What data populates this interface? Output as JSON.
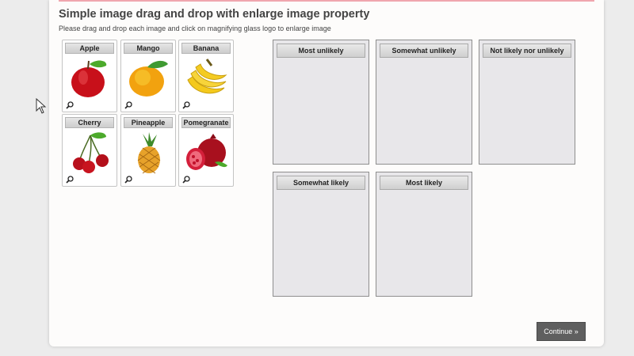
{
  "header": {
    "title": "Simple image drag and drop with enlarge image property",
    "subtitle": "Please drag and drop each image and click on magnifying glass logo to enlarge image"
  },
  "images": [
    {
      "label": "Apple"
    },
    {
      "label": "Mango"
    },
    {
      "label": "Banana"
    },
    {
      "label": "Cherry"
    },
    {
      "label": "Pineapple"
    },
    {
      "label": "Pomegranate"
    }
  ],
  "buckets": [
    {
      "label": "Most unlikely"
    },
    {
      "label": "Somewhat unlikely"
    },
    {
      "label": "Not likely nor unlikely"
    },
    {
      "label": "Somewhat likely"
    },
    {
      "label": "Most likely"
    }
  ],
  "footer": {
    "continue_label": "Continue »"
  },
  "colors": {
    "accent_bar": "#f0a6ae",
    "continue_bg": "#5f5f5f",
    "bucket_bg": "#e8e7ea"
  },
  "icons": {
    "zoom": "magnifying-glass-icon",
    "cursor": "mouse-pointer-icon"
  }
}
